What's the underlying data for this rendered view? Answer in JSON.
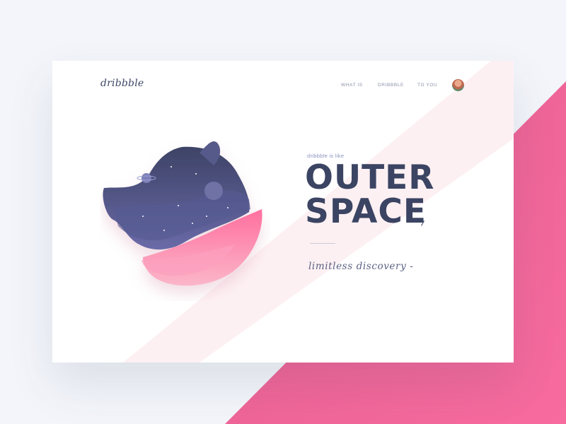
{
  "brand": {
    "logo_text": "dribbble"
  },
  "nav": {
    "items": [
      {
        "label": "WHAT IS"
      },
      {
        "label": "DRIBBBLE"
      },
      {
        "label": "TO YOU"
      }
    ]
  },
  "hero": {
    "kicker": "dribbble is like",
    "headline_line1": "OUTER",
    "headline_line2": "SPACE",
    "tagline": "limitless discovery -"
  },
  "colors": {
    "pink_accent": "#f0639a",
    "navy_text": "#3b4462",
    "stripe_light": "#fdf0f3"
  },
  "icons": {
    "avatar": "user-avatar-icon",
    "planet": "planet-illustration"
  }
}
